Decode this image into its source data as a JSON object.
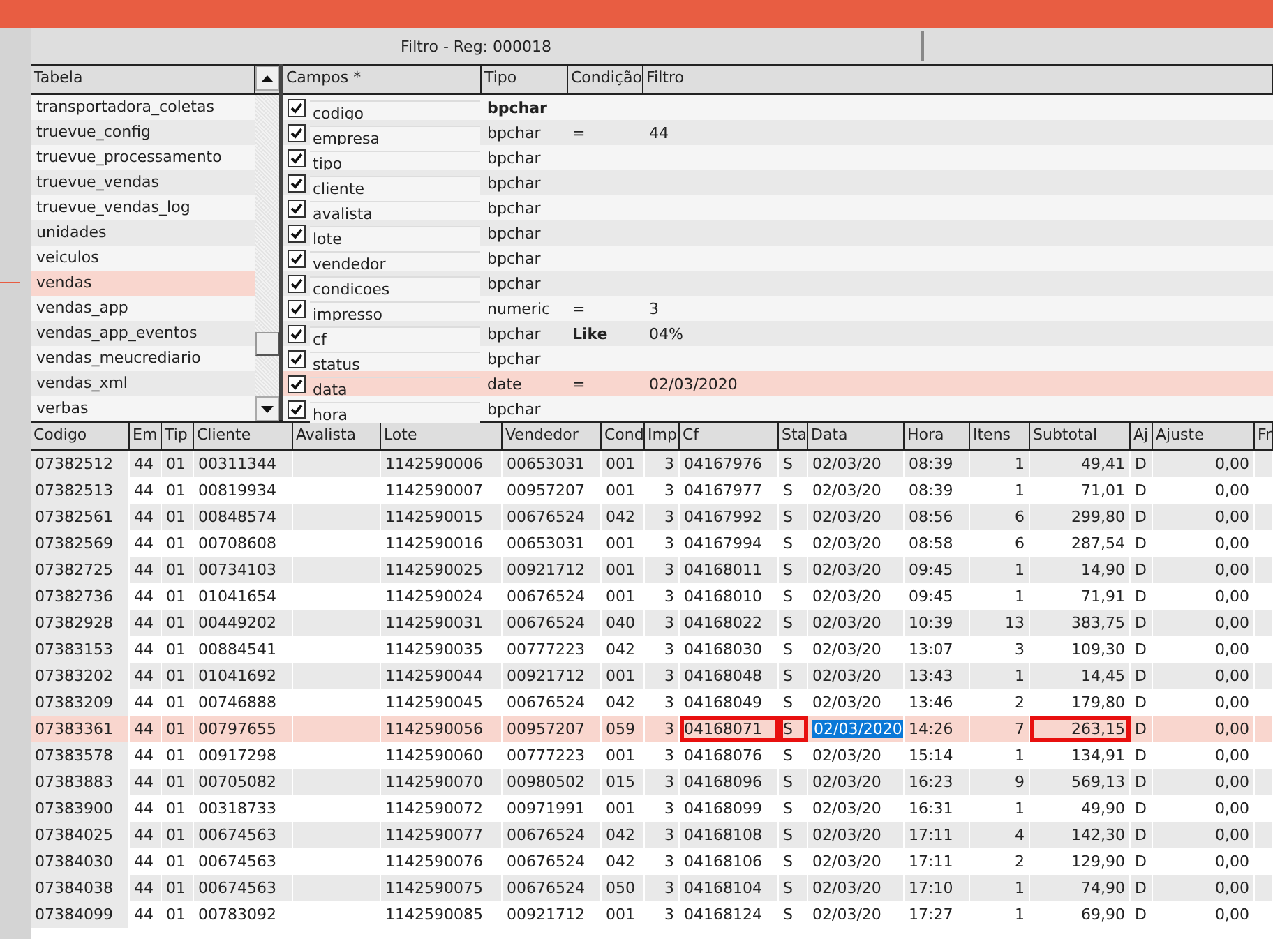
{
  "title": "Filtro - Reg: 000018",
  "tables": {
    "header": "Tabela",
    "items": [
      {
        "name": "transportadora_coletas",
        "selected": false
      },
      {
        "name": "truevue_config",
        "selected": false
      },
      {
        "name": "truevue_processamento",
        "selected": false
      },
      {
        "name": "truevue_vendas",
        "selected": false
      },
      {
        "name": "truevue_vendas_log",
        "selected": false
      },
      {
        "name": "unidades",
        "selected": false
      },
      {
        "name": "veiculos",
        "selected": false
      },
      {
        "name": "vendas",
        "selected": true
      },
      {
        "name": "vendas_app",
        "selected": false
      },
      {
        "name": "vendas_app_eventos",
        "selected": false
      },
      {
        "name": "vendas_meucrediario",
        "selected": false
      },
      {
        "name": "vendas_xml",
        "selected": false
      },
      {
        "name": "verbas",
        "selected": false
      }
    ]
  },
  "fields": {
    "columns": [
      "Campos *",
      "Tipo",
      "Condição",
      "Filtro"
    ],
    "rows": [
      {
        "checked": true,
        "name": "codigo",
        "type": "bpchar",
        "type_bold": true,
        "condition": "",
        "condition_bold": false,
        "filter": "",
        "selected": false
      },
      {
        "checked": true,
        "name": "empresa",
        "type": "bpchar",
        "type_bold": false,
        "condition": "=",
        "condition_bold": false,
        "filter": "44",
        "selected": false
      },
      {
        "checked": true,
        "name": "tipo",
        "type": "bpchar",
        "type_bold": false,
        "condition": "",
        "condition_bold": false,
        "filter": "",
        "selected": false
      },
      {
        "checked": true,
        "name": "cliente",
        "type": "bpchar",
        "type_bold": false,
        "condition": "",
        "condition_bold": false,
        "filter": "",
        "selected": false
      },
      {
        "checked": true,
        "name": "avalista",
        "type": "bpchar",
        "type_bold": false,
        "condition": "",
        "condition_bold": false,
        "filter": "",
        "selected": false
      },
      {
        "checked": true,
        "name": "lote",
        "type": "bpchar",
        "type_bold": false,
        "condition": "",
        "condition_bold": false,
        "filter": "",
        "selected": false
      },
      {
        "checked": true,
        "name": "vendedor",
        "type": "bpchar",
        "type_bold": false,
        "condition": "",
        "condition_bold": false,
        "filter": "",
        "selected": false
      },
      {
        "checked": true,
        "name": "condicoes",
        "type": "bpchar",
        "type_bold": false,
        "condition": "",
        "condition_bold": false,
        "filter": "",
        "selected": false
      },
      {
        "checked": true,
        "name": "impresso",
        "type": "numeric",
        "type_bold": false,
        "condition": "=",
        "condition_bold": false,
        "filter": "3",
        "selected": false
      },
      {
        "checked": true,
        "name": "cf",
        "type": "bpchar",
        "type_bold": false,
        "condition": "Like",
        "condition_bold": true,
        "filter": "04%",
        "selected": false
      },
      {
        "checked": true,
        "name": "status",
        "type": "bpchar",
        "type_bold": false,
        "condition": "",
        "condition_bold": false,
        "filter": "",
        "selected": false
      },
      {
        "checked": true,
        "name": "data",
        "type": "date",
        "type_bold": false,
        "condition": "=",
        "condition_bold": false,
        "filter": "02/03/2020",
        "selected": true
      },
      {
        "checked": true,
        "name": "hora",
        "type": "bpchar",
        "type_bold": false,
        "condition": "",
        "condition_bold": false,
        "filter": "",
        "selected": false
      }
    ]
  },
  "grid": {
    "columns": [
      "Codigo",
      "Em",
      "Tip",
      "Cliente",
      "Avalista",
      "Lote",
      "Vendedor",
      "Cond",
      "Imp",
      "Cf",
      "Sta",
      "Data",
      "Hora",
      "Itens",
      "Subtotal",
      "Aj",
      "Ajuste",
      "Fr"
    ],
    "rows": [
      {
        "selected": false,
        "cells": [
          "07382512",
          "44",
          "01",
          "00311344",
          "",
          "1142590006",
          "00653031",
          "001",
          "3",
          "04167976",
          "S",
          "02/03/20",
          "08:39",
          "1",
          "49,41",
          "D",
          "0,00",
          ""
        ]
      },
      {
        "selected": false,
        "cells": [
          "07382513",
          "44",
          "01",
          "00819934",
          "",
          "1142590007",
          "00957207",
          "001",
          "3",
          "04167977",
          "S",
          "02/03/20",
          "08:39",
          "1",
          "71,01",
          "D",
          "0,00",
          ""
        ]
      },
      {
        "selected": false,
        "cells": [
          "07382561",
          "44",
          "01",
          "00848574",
          "",
          "1142590015",
          "00676524",
          "042",
          "3",
          "04167992",
          "S",
          "02/03/20",
          "08:56",
          "6",
          "299,80",
          "D",
          "0,00",
          ""
        ]
      },
      {
        "selected": false,
        "cells": [
          "07382569",
          "44",
          "01",
          "00708608",
          "",
          "1142590016",
          "00653031",
          "001",
          "3",
          "04167994",
          "S",
          "02/03/20",
          "08:58",
          "6",
          "287,54",
          "D",
          "0,00",
          ""
        ]
      },
      {
        "selected": false,
        "cells": [
          "07382725",
          "44",
          "01",
          "00734103",
          "",
          "1142590025",
          "00921712",
          "001",
          "3",
          "04168011",
          "S",
          "02/03/20",
          "09:45",
          "1",
          "14,90",
          "D",
          "0,00",
          ""
        ]
      },
      {
        "selected": false,
        "cells": [
          "07382736",
          "44",
          "01",
          "01041654",
          "",
          "1142590024",
          "00676524",
          "001",
          "3",
          "04168010",
          "S",
          "02/03/20",
          "09:45",
          "1",
          "71,91",
          "D",
          "0,00",
          ""
        ]
      },
      {
        "selected": false,
        "cells": [
          "07382928",
          "44",
          "01",
          "00449202",
          "",
          "1142590031",
          "00676524",
          "040",
          "3",
          "04168022",
          "S",
          "02/03/20",
          "10:39",
          "13",
          "383,75",
          "D",
          "0,00",
          ""
        ]
      },
      {
        "selected": false,
        "cells": [
          "07383153",
          "44",
          "01",
          "00884541",
          "",
          "1142590035",
          "00777223",
          "042",
          "3",
          "04168030",
          "S",
          "02/03/20",
          "13:07",
          "3",
          "109,30",
          "D",
          "0,00",
          ""
        ]
      },
      {
        "selected": false,
        "cells": [
          "07383202",
          "44",
          "01",
          "01041692",
          "",
          "1142590044",
          "00921712",
          "001",
          "3",
          "04168048",
          "S",
          "02/03/20",
          "13:43",
          "1",
          "14,45",
          "D",
          "0,00",
          ""
        ]
      },
      {
        "selected": false,
        "cells": [
          "07383209",
          "44",
          "01",
          "00746888",
          "",
          "1142590045",
          "00676524",
          "042",
          "3",
          "04168049",
          "S",
          "02/03/20",
          "13:46",
          "2",
          "179,80",
          "D",
          "0,00",
          ""
        ]
      },
      {
        "selected": true,
        "cells": [
          "07383361",
          "44",
          "01",
          "00797655",
          "",
          "1142590056",
          "00957207",
          "059",
          "3",
          {
            "text": "04168071",
            "boxed": true
          },
          {
            "text": "S",
            "boxed": true
          },
          {
            "text": "02/03/2020",
            "editing": true
          },
          "14:26",
          "7",
          {
            "text": "263,15",
            "boxed": true
          },
          "D",
          "0,00",
          ""
        ]
      },
      {
        "selected": false,
        "cells": [
          "07383578",
          "44",
          "01",
          "00917298",
          "",
          "1142590060",
          "00777223",
          "001",
          "3",
          "04168076",
          "S",
          "02/03/20",
          "15:14",
          "1",
          "134,91",
          "D",
          "0,00",
          ""
        ]
      },
      {
        "selected": false,
        "cells": [
          "07383883",
          "44",
          "01",
          "00705082",
          "",
          "1142590070",
          "00980502",
          "015",
          "3",
          "04168096",
          "S",
          "02/03/20",
          "16:23",
          "9",
          "569,13",
          "D",
          "0,00",
          ""
        ]
      },
      {
        "selected": false,
        "cells": [
          "07383900",
          "44",
          "01",
          "00318733",
          "",
          "1142590072",
          "00971991",
          "001",
          "3",
          "04168099",
          "S",
          "02/03/20",
          "16:31",
          "1",
          "49,90",
          "D",
          "0,00",
          ""
        ]
      },
      {
        "selected": false,
        "cells": [
          "07384025",
          "44",
          "01",
          "00674563",
          "",
          "1142590077",
          "00676524",
          "042",
          "3",
          "04168108",
          "S",
          "02/03/20",
          "17:11",
          "4",
          "142,30",
          "D",
          "0,00",
          ""
        ]
      },
      {
        "selected": false,
        "cells": [
          "07384030",
          "44",
          "01",
          "00674563",
          "",
          "1142590076",
          "00676524",
          "042",
          "3",
          "04168106",
          "S",
          "02/03/20",
          "17:11",
          "2",
          "129,90",
          "D",
          "0,00",
          ""
        ]
      },
      {
        "selected": false,
        "cells": [
          "07384038",
          "44",
          "01",
          "00674563",
          "",
          "1142590075",
          "00676524",
          "050",
          "3",
          "04168104",
          "S",
          "02/03/20",
          "17:10",
          "1",
          "74,90",
          "D",
          "0,00",
          ""
        ]
      },
      {
        "selected": false,
        "cells": [
          "07384099",
          "44",
          "01",
          "00783092",
          "",
          "1142590085",
          "00921712",
          "001",
          "3",
          "04168124",
          "S",
          "02/03/20",
          "17:27",
          "1",
          "69,90",
          "D",
          "0,00",
          ""
        ]
      }
    ]
  }
}
